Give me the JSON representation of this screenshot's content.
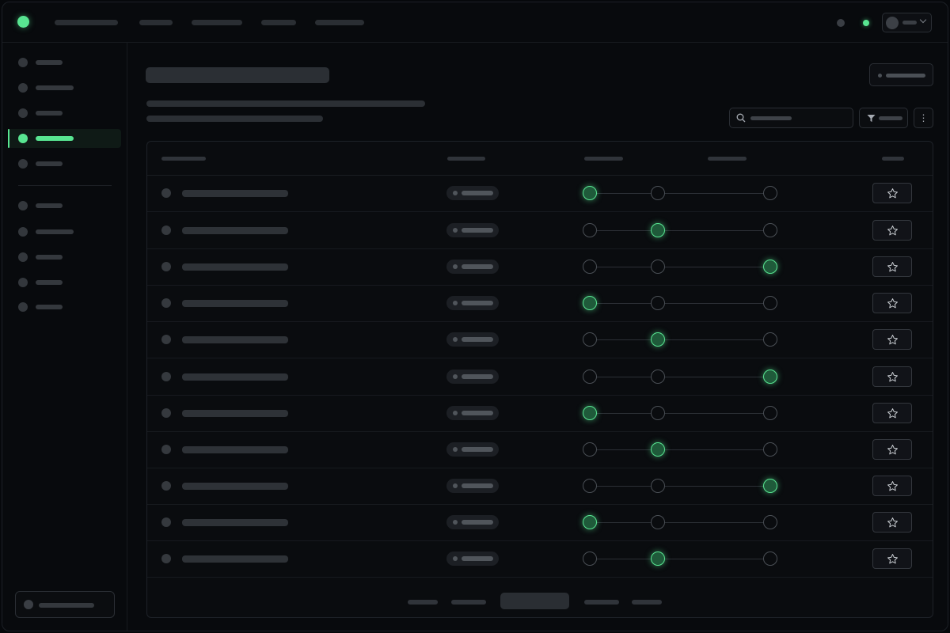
{
  "header": {
    "logo_icon": "brand-dot-icon",
    "nav_items": [
      {
        "label": "",
        "width": 80
      },
      {
        "label": "",
        "width": 42
      },
      {
        "label": "",
        "width": 64
      },
      {
        "label": "",
        "width": 44
      },
      {
        "label": "",
        "width": 62
      }
    ],
    "status_icons": [
      "notifications-icon",
      "online-status-icon"
    ],
    "account_menu": {
      "avatar_icon": "avatar-icon",
      "dropdown_icon": "chevron-down-icon"
    }
  },
  "sidebar": {
    "items": [
      {
        "label": "",
        "active": false
      },
      {
        "label": "",
        "active": false
      },
      {
        "label": "",
        "active": false
      },
      {
        "label": "",
        "active": true
      },
      {
        "label": "",
        "active": false
      }
    ],
    "secondary_items": [
      {
        "label": ""
      },
      {
        "label": ""
      },
      {
        "label": ""
      },
      {
        "label": ""
      },
      {
        "label": ""
      }
    ],
    "footer_label": ""
  },
  "main": {
    "title": "",
    "subtitle_lines": [
      "",
      ""
    ],
    "primary_action_label": "",
    "search": {
      "placeholder": "",
      "icon": "search-icon"
    },
    "filter": {
      "label": "",
      "icon": "filter-icon"
    },
    "more_icon": "more-vertical-icon"
  },
  "table": {
    "columns": [
      "",
      "",
      "",
      "",
      ""
    ],
    "rows": [
      {
        "name": "",
        "badge": "",
        "stage": 0,
        "starred": false
      },
      {
        "name": "",
        "badge": "",
        "stage": 1,
        "starred": false
      },
      {
        "name": "",
        "badge": "",
        "stage": 2,
        "starred": false
      },
      {
        "name": "",
        "badge": "",
        "stage": 0,
        "starred": false
      },
      {
        "name": "",
        "badge": "",
        "stage": 1,
        "starred": false
      },
      {
        "name": "",
        "badge": "",
        "stage": 2,
        "starred": false
      },
      {
        "name": "",
        "badge": "",
        "stage": 0,
        "starred": false
      },
      {
        "name": "",
        "badge": "",
        "stage": 1,
        "starred": false
      },
      {
        "name": "",
        "badge": "",
        "stage": 2,
        "starred": false
      },
      {
        "name": "",
        "badge": "",
        "stage": 0,
        "starred": false
      },
      {
        "name": "",
        "badge": "",
        "stage": 1,
        "starred": false
      }
    ],
    "stage_count": 3
  },
  "pagination": {
    "links": [
      "",
      "",
      "",
      ""
    ],
    "current": ""
  },
  "colors": {
    "accent": "#58e591",
    "background": "#080a0d",
    "placeholder": "#2b2f34"
  }
}
